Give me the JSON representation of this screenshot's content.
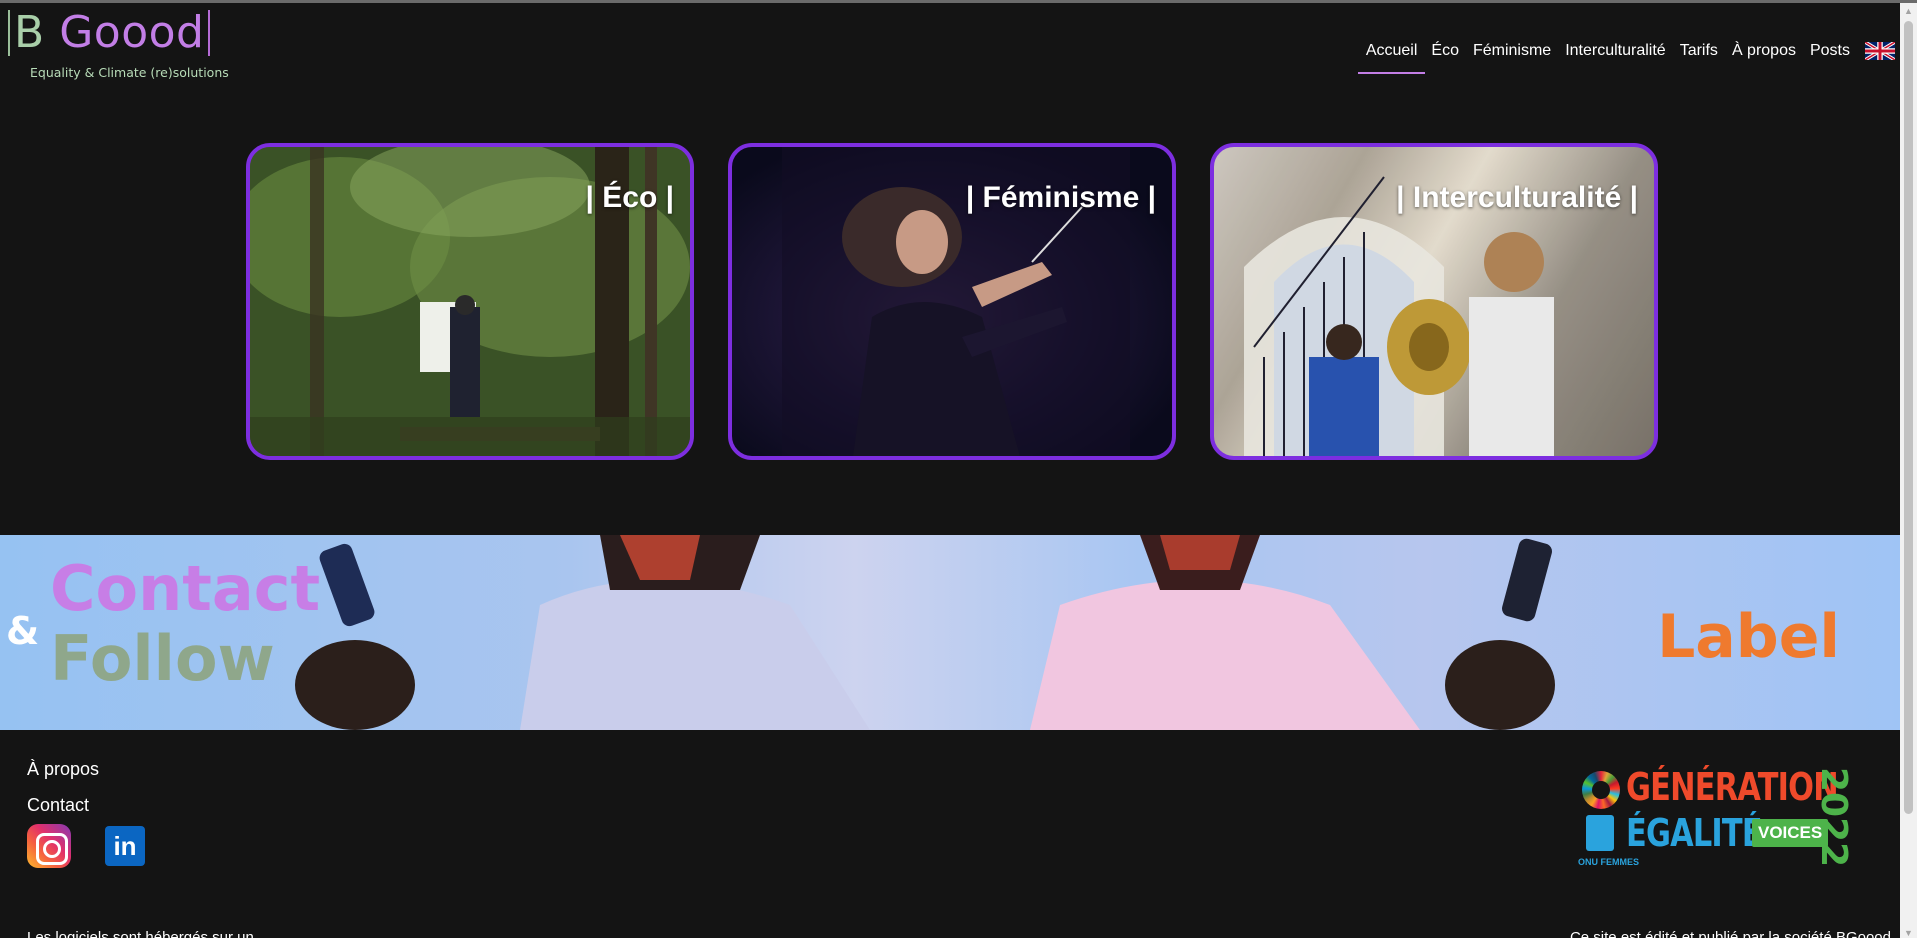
{
  "header": {
    "logo": {
      "letter": "B",
      "word": "Goood",
      "tagline": "Equality & Climate (re)solutions"
    },
    "nav": [
      {
        "label": "Accueil",
        "active": true
      },
      {
        "label": "Éco"
      },
      {
        "label": "Féminisme"
      },
      {
        "label": "Interculturalité"
      },
      {
        "label": "Tarifs"
      },
      {
        "label": "À propos"
      },
      {
        "label": "Posts"
      }
    ],
    "language_flag": "uk-flag-icon"
  },
  "cards": [
    {
      "label": "| Éco |"
    },
    {
      "label": "| Féminisme |"
    },
    {
      "label": "| Interculturalité |"
    }
  ],
  "banner": {
    "amp": "&",
    "contact": "Contact",
    "follow": "Follow",
    "label": "Label"
  },
  "footer": {
    "links": [
      "À propos",
      "Contact"
    ],
    "social": [
      {
        "name": "instagram-icon"
      },
      {
        "name": "linkedin-icon",
        "text": "in"
      }
    ],
    "badge": {
      "line1": "GÉNÉRATION",
      "line2": "ÉGALITÉ",
      "voices": "VOICES",
      "year": "2022",
      "org": "ONU FEMMES"
    },
    "legal_left": "Les logiciels sont hébergés sur un",
    "legal_right": "Ce site est édité et publié par la société BGoood"
  },
  "colors": {
    "accent_purple": "#7d2ee0",
    "logo_green": "#a9cfa9",
    "logo_purple": "#c27ee6",
    "label_orange": "#ef7a2e"
  }
}
